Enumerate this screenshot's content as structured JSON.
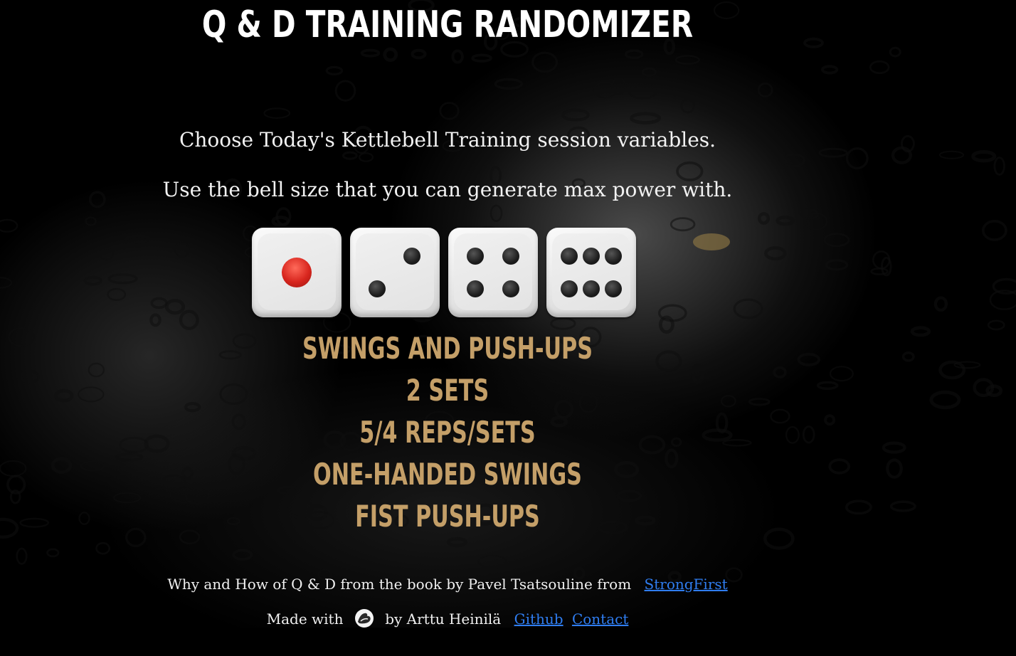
{
  "header": {
    "title": "Q & D TRAINING RANDOMIZER"
  },
  "intro": {
    "line1": "Choose Today's Kettlebell Training session variables.",
    "line2": "Use the bell size that you can generate max power with."
  },
  "dice": [
    {
      "value": 1,
      "pip_color": "#d8261e"
    },
    {
      "value": 2,
      "pip_color": "#1d1d1d"
    },
    {
      "value": 4,
      "pip_color": "#1d1d1d"
    },
    {
      "value": 6,
      "pip_color": "#1d1d1d"
    }
  ],
  "results": [
    "SWINGS AND PUSH-UPS",
    "2 SETS",
    "5/4 REPS/SETS",
    "ONE-HANDED SWINGS",
    "FIST PUSH-UPS"
  ],
  "footer": {
    "credit_text": "Why and How of Q & D from the book by Pavel Tsatsouline from",
    "strongfirst_link": "StrongFirst",
    "made_with": "Made with",
    "by_author": "by Arttu Heinilä",
    "github_link": "Github",
    "contact_link": "Contact",
    "icon": "flexed-biceps-icon"
  },
  "colors": {
    "background": "#000000",
    "accent_gold": "#c49f68",
    "link_blue": "#2f7df0",
    "text": "#ffffff"
  }
}
